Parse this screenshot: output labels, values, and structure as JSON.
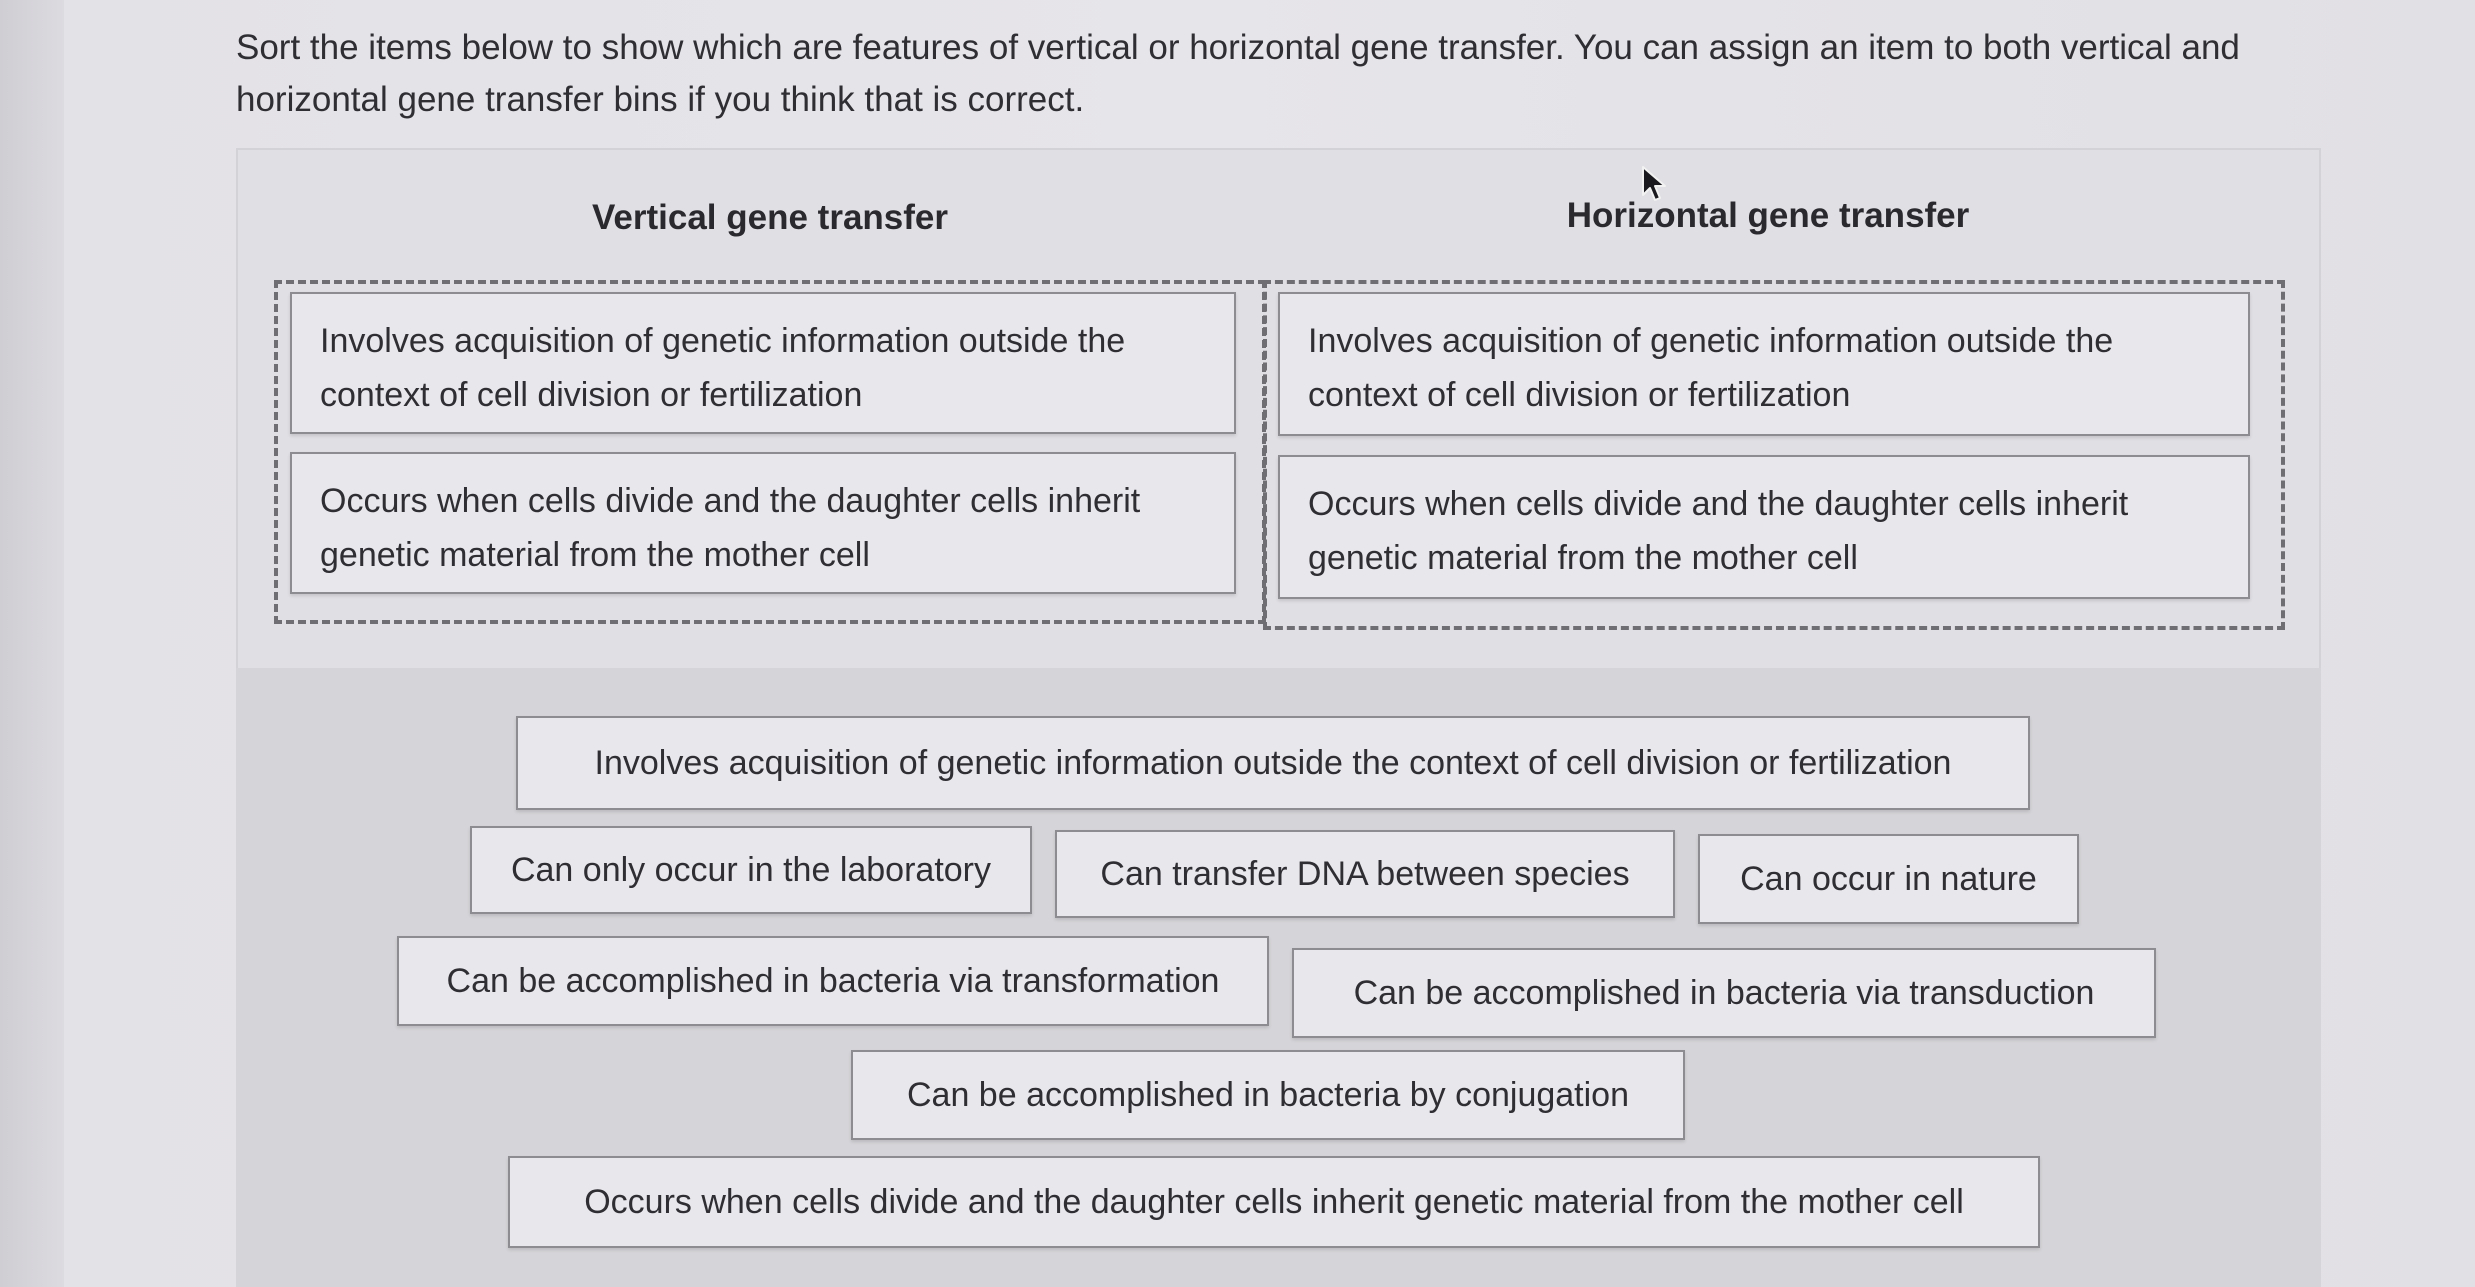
{
  "instructions": "Sort the items below to show which are features of vertical or horizontal gene transfer. You can assign an item to both vertical and horizontal gene transfer bins if you think that is correct.",
  "bins": {
    "vertical": {
      "title": "Vertical gene transfer",
      "items": [
        "Involves acquisition of genetic information outside the context of cell division or fertilization",
        "Occurs when cells divide and the daughter cells inherit genetic material from the mother cell"
      ]
    },
    "horizontal": {
      "title": "Horizontal gene transfer",
      "items": [
        "Involves acquisition of genetic information outside the context of cell division or fertilization",
        "Occurs when cells divide and the daughter cells inherit genetic material from the mother cell"
      ]
    }
  },
  "pool": [
    "Involves acquisition of genetic information outside the context of cell division or fertilization",
    "Can only occur in the laboratory",
    "Can transfer DNA between species",
    "Can occur in nature",
    "Can be accomplished in bacteria via transformation",
    "Can be accomplished in bacteria via transduction",
    "Can be accomplished in bacteria by conjugation",
    "Occurs when cells divide and the daughter cells inherit genetic material from the mother cell"
  ]
}
